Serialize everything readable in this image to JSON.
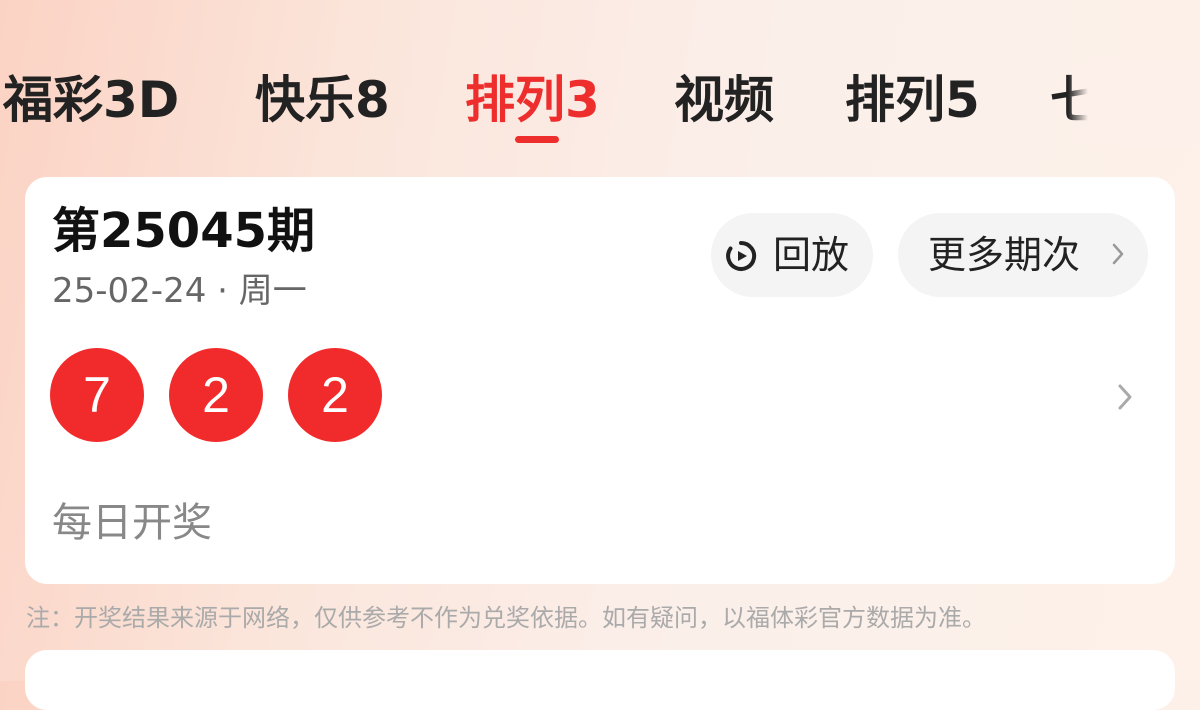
{
  "tabs": [
    {
      "label": "福彩3D",
      "active": false
    },
    {
      "label": "快乐8",
      "active": false
    },
    {
      "label": "排列3",
      "active": true
    },
    {
      "label": "视频",
      "active": false
    },
    {
      "label": "排列5",
      "active": false
    },
    {
      "label": "七",
      "active": false
    }
  ],
  "card": {
    "issue_title": "第25045期",
    "draw_date": "25-02-24 · 周一",
    "replay_button": {
      "label": "回放",
      "icon": "replay-icon"
    },
    "more_button": {
      "label": "更多期次",
      "icon": "chevron-right-icon"
    },
    "balls": [
      "7",
      "2",
      "2"
    ],
    "frequency": "每日开奖"
  },
  "disclaimer": "注：开奖结果来源于网络，仅供参考不作为兑奖依据。如有疑问，以福体彩官方数据为准。",
  "icons": {
    "menu": "menu-icon"
  },
  "colors": {
    "accent": "#ee2d2d",
    "ball": "#f12b2b"
  }
}
